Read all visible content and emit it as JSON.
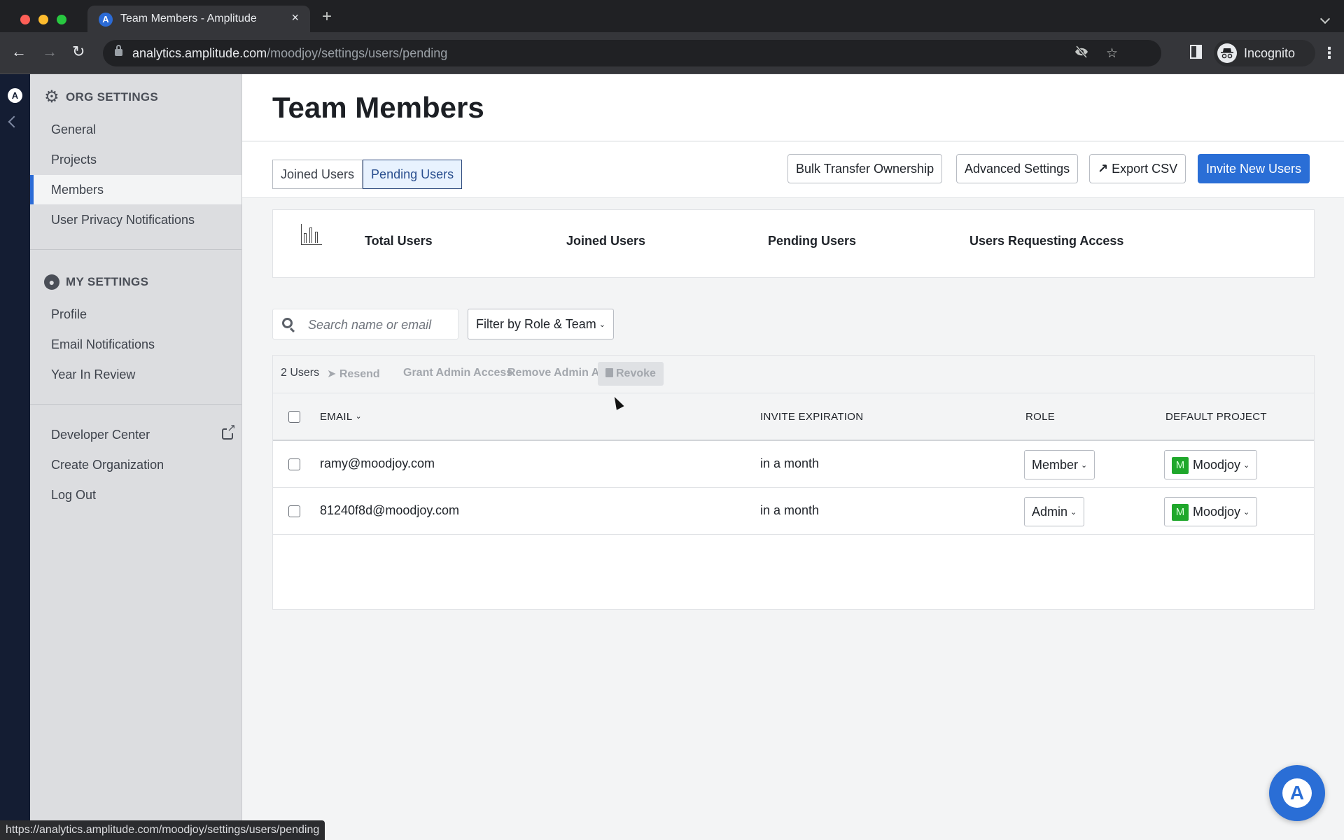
{
  "browser": {
    "tab_title": "Team Members - Amplitude",
    "tab_favicon": "amplitude-logo",
    "new_tab": "+",
    "close": "×",
    "url_host": "analytics.amplitude.com",
    "url_path": "/moodjoy/settings/users/pending",
    "profile_label": "Incognito",
    "status_url": "https://analytics.amplitude.com/moodjoy/settings/users/pending",
    "icons": {
      "back": "←",
      "forward": "→",
      "reload": "↻",
      "eye_off": "eye-off-icon",
      "star": "☆",
      "kebab": "⋮"
    }
  },
  "rail": {
    "logo": "A"
  },
  "sidebar": {
    "org_header": "ORG SETTINGS",
    "org_items": [
      {
        "label": "General",
        "active": false
      },
      {
        "label": "Projects",
        "active": false
      },
      {
        "label": "Members",
        "active": true
      },
      {
        "label": "User Privacy Notifications",
        "active": false
      }
    ],
    "my_header": "MY SETTINGS",
    "my_items": [
      {
        "label": "Profile"
      },
      {
        "label": "Email Notifications"
      },
      {
        "label": "Year In Review"
      }
    ],
    "footer_items": [
      {
        "label": "Developer Center",
        "external": true
      },
      {
        "label": "Create Organization"
      },
      {
        "label": "Log Out"
      }
    ]
  },
  "header": {
    "title": "Team Members"
  },
  "tabs": [
    {
      "label": "Joined Users",
      "active": false
    },
    {
      "label": "Pending Users",
      "active": true
    }
  ],
  "actions": {
    "bulk_transfer": "Bulk Transfer Ownership",
    "advanced_settings": "Advanced Settings",
    "export_csv": "Export CSV",
    "invite": "Invite New Users"
  },
  "stats": {
    "labels": [
      "Total Users",
      "Joined Users",
      "Pending Users",
      "Users Requesting Access"
    ]
  },
  "search": {
    "placeholder": "Search name or email",
    "value": ""
  },
  "filter": {
    "label": "Filter by Role & Team"
  },
  "bulk": {
    "count": "2 Users",
    "resend": "Resend",
    "grant_admin": "Grant Admin Access",
    "remove_admin": "Remove Admin Access",
    "revoke": "Revoke"
  },
  "table": {
    "columns": [
      "EMAIL",
      "INVITE EXPIRATION",
      "ROLE",
      "DEFAULT PROJECT"
    ],
    "rows": [
      {
        "email": "ramy@moodjoy.com",
        "expiration": "in a month",
        "role": "Member",
        "project": "Moodjoy",
        "project_badge": "M",
        "checked": false
      },
      {
        "email": "81240f8d@moodjoy.com",
        "expiration": "in a month",
        "role": "Admin",
        "project": "Moodjoy",
        "project_badge": "M",
        "checked": false
      }
    ]
  },
  "colors": {
    "accent": "#2a6ed6",
    "rail": "#141d33",
    "sidebar": "#dcdde0",
    "project_badge": "#1fa72b"
  }
}
